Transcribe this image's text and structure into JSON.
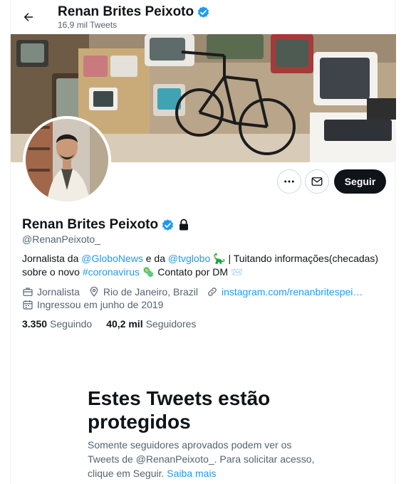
{
  "header": {
    "name": "Renan Brites Peixoto",
    "tweet_count": "16,9 mil Tweets"
  },
  "actions": {
    "more_icon": "more-horizontal-icon",
    "message_icon": "envelope-icon",
    "follow_label": "Seguir"
  },
  "profile": {
    "name": "Renan Brites Peixoto",
    "handle": "@RenanPeixoto_",
    "bio": {
      "p1": "Jornalista da ",
      "link1": "@GloboNews",
      "p2": " e da ",
      "link2": "@tvglobo",
      "p3": " 🦕 | Tuitando informações(checadas) sobre o novo ",
      "link3": "#coronavirus",
      "p4": " 🦠 Contato por DM 📨"
    },
    "profession": "Jornalista",
    "location": "Rio de Janeiro, Brazil",
    "website": "instagram.com/renanbritespei…",
    "joined": "Ingressou em junho de 2019",
    "following_count": "3.350",
    "following_label": "Seguindo",
    "followers_count": "40,2 mil",
    "followers_label": "Seguidores"
  },
  "protected": {
    "title": "Estes Tweets estão protegidos",
    "text": "Somente seguidores aprovados podem ver os Tweets de @RenanPeixoto_. Para solicitar acesso, clique em Seguir. ",
    "learn_more": "Saiba mais"
  },
  "colors": {
    "accent": "#1d9bf0",
    "text": "#0f1419",
    "secondary": "#536471",
    "button": "#0f1419"
  }
}
